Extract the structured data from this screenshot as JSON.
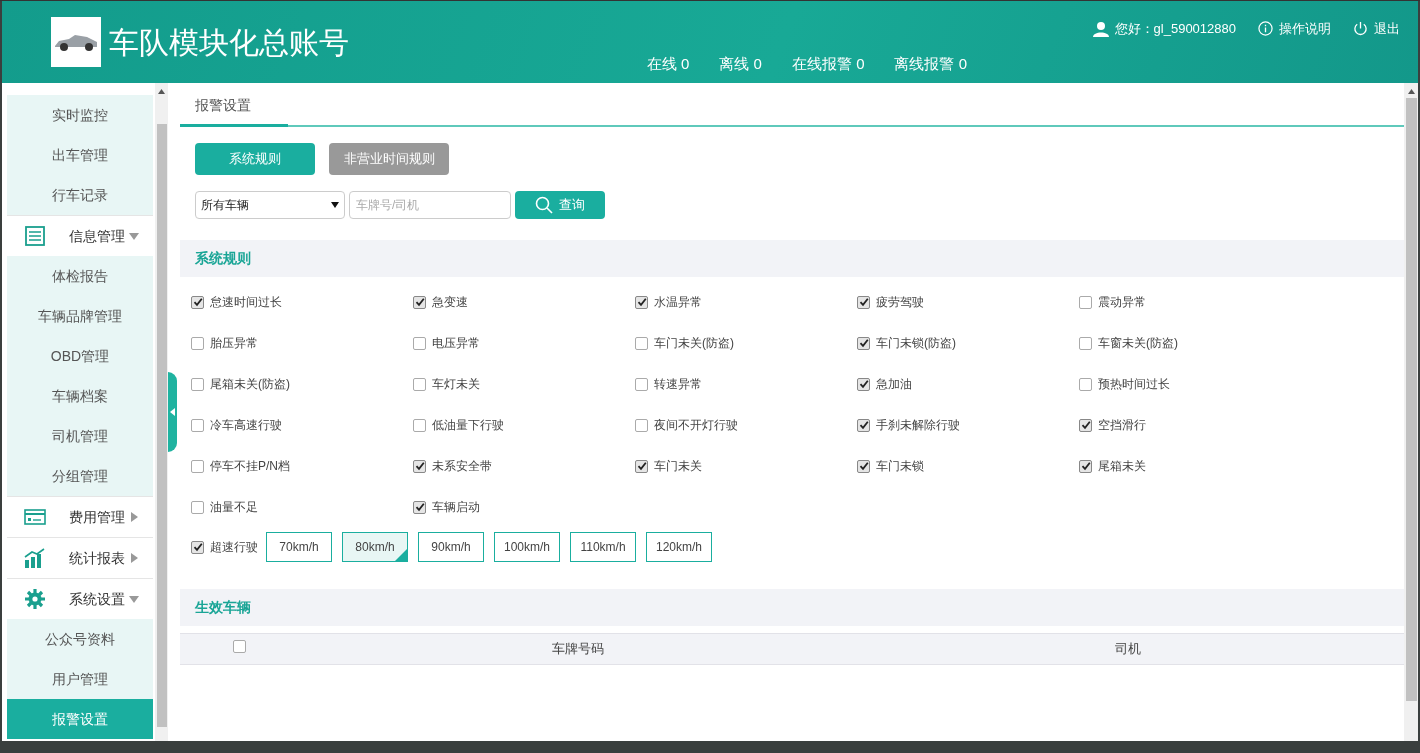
{
  "header": {
    "title": "车队模块化总账号",
    "stats": [
      "在线 0",
      "离线 0",
      "在线报警 0",
      "离线报警 0"
    ],
    "user": "您好：gl_590012880",
    "help": "操作说明",
    "logout": "退出"
  },
  "sidebar": {
    "items": [
      {
        "kind": "link",
        "label": "实时监控",
        "selected": false
      },
      {
        "kind": "link",
        "label": "出车管理",
        "selected": false
      },
      {
        "kind": "link",
        "label": "行车记录",
        "selected": false
      },
      {
        "kind": "group",
        "label": "信息管理",
        "expanded": true,
        "children": [
          {
            "label": "体检报告",
            "selected": false
          },
          {
            "label": "车辆品牌管理",
            "selected": false
          },
          {
            "label": "OBD管理",
            "selected": false
          },
          {
            "label": "车辆档案",
            "selected": false
          },
          {
            "label": "司机管理",
            "selected": false
          },
          {
            "label": "分组管理",
            "selected": false
          }
        ]
      },
      {
        "kind": "group",
        "label": "费用管理",
        "expanded": false
      },
      {
        "kind": "group",
        "label": "统计报表",
        "expanded": false
      },
      {
        "kind": "group",
        "label": "系统设置",
        "expanded": true,
        "children": [
          {
            "label": "公众号资料",
            "selected": false
          },
          {
            "label": "用户管理",
            "selected": false
          },
          {
            "label": "报警设置",
            "selected": true
          }
        ]
      }
    ]
  },
  "tabs": [
    {
      "label": "报警设置",
      "selected": true
    }
  ],
  "rule_buttons": [
    {
      "label": "系统规则",
      "selected": true
    },
    {
      "label": "非营业时间规则",
      "selected": false
    }
  ],
  "filter": {
    "select": "所有车辆",
    "search_placeholder": "车牌号/司机",
    "query": "查询"
  },
  "rules_section": {
    "title": "系统规则",
    "rules": [
      {
        "label": "怠速时间过长",
        "checked": true
      },
      {
        "label": "急变速",
        "checked": true
      },
      {
        "label": "水温异常",
        "checked": true
      },
      {
        "label": "疲劳驾驶",
        "checked": true
      },
      {
        "label": "震动异常",
        "checked": false
      },
      {
        "label": "胎压异常",
        "checked": false
      },
      {
        "label": "电压异常",
        "checked": false
      },
      {
        "label": "车门未关(防盗)",
        "checked": false
      },
      {
        "label": "车门未锁(防盗)",
        "checked": true
      },
      {
        "label": "车窗未关(防盗)",
        "checked": false
      },
      {
        "label": "尾箱未关(防盗)",
        "checked": false
      },
      {
        "label": "车灯未关",
        "checked": false
      },
      {
        "label": "转速异常",
        "checked": false
      },
      {
        "label": "急加油",
        "checked": true
      },
      {
        "label": "预热时间过长",
        "checked": false
      },
      {
        "label": "冷车高速行驶",
        "checked": false
      },
      {
        "label": "低油量下行驶",
        "checked": false
      },
      {
        "label": "夜间不开灯行驶",
        "checked": false
      },
      {
        "label": "手刹未解除行驶",
        "checked": true
      },
      {
        "label": "空挡滑行",
        "checked": true
      },
      {
        "label": "停车不挂P/N档",
        "checked": false
      },
      {
        "label": "未系安全带",
        "checked": true
      },
      {
        "label": "车门未关",
        "checked": true
      },
      {
        "label": "车门未锁",
        "checked": true
      },
      {
        "label": "尾箱未关",
        "checked": true
      },
      {
        "label": "油量不足",
        "checked": false
      },
      {
        "label": "车辆启动",
        "checked": true
      }
    ],
    "speeding": {
      "label": "超速行驶",
      "checked": true,
      "options": [
        {
          "label": "70km/h",
          "selected": false
        },
        {
          "label": "80km/h",
          "selected": true
        },
        {
          "label": "90km/h",
          "selected": false
        },
        {
          "label": "100km/h",
          "selected": false
        },
        {
          "label": "110km/h",
          "selected": false
        },
        {
          "label": "120km/h",
          "selected": false
        }
      ]
    }
  },
  "vehicles_section": {
    "title": "生效车辆",
    "select_all": false,
    "columns": [
      "车牌号码",
      "司机"
    ]
  }
}
